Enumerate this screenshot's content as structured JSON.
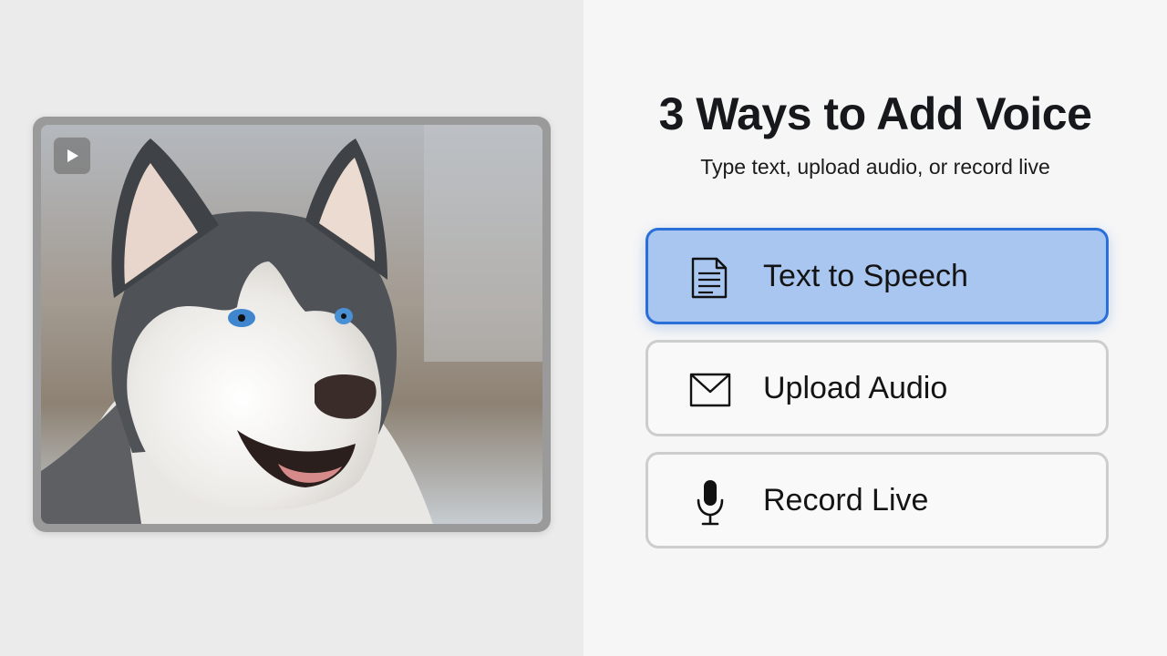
{
  "video": {
    "play_icon": "play-icon"
  },
  "header": {
    "title": "3 Ways to Add Voice",
    "subtitle": "Type text, upload audio, or record live"
  },
  "options": [
    {
      "label": "Text to Speech",
      "icon": "document-icon",
      "selected": true
    },
    {
      "label": "Upload Audio",
      "icon": "envelope-icon",
      "selected": false
    },
    {
      "label": "Record Live",
      "icon": "microphone-icon",
      "selected": false
    }
  ],
  "colors": {
    "accent": "#2a6fd8",
    "selected_fill": "#a9c6f0",
    "left_background": "#ebebeb",
    "right_background": "#f6f6f6"
  }
}
